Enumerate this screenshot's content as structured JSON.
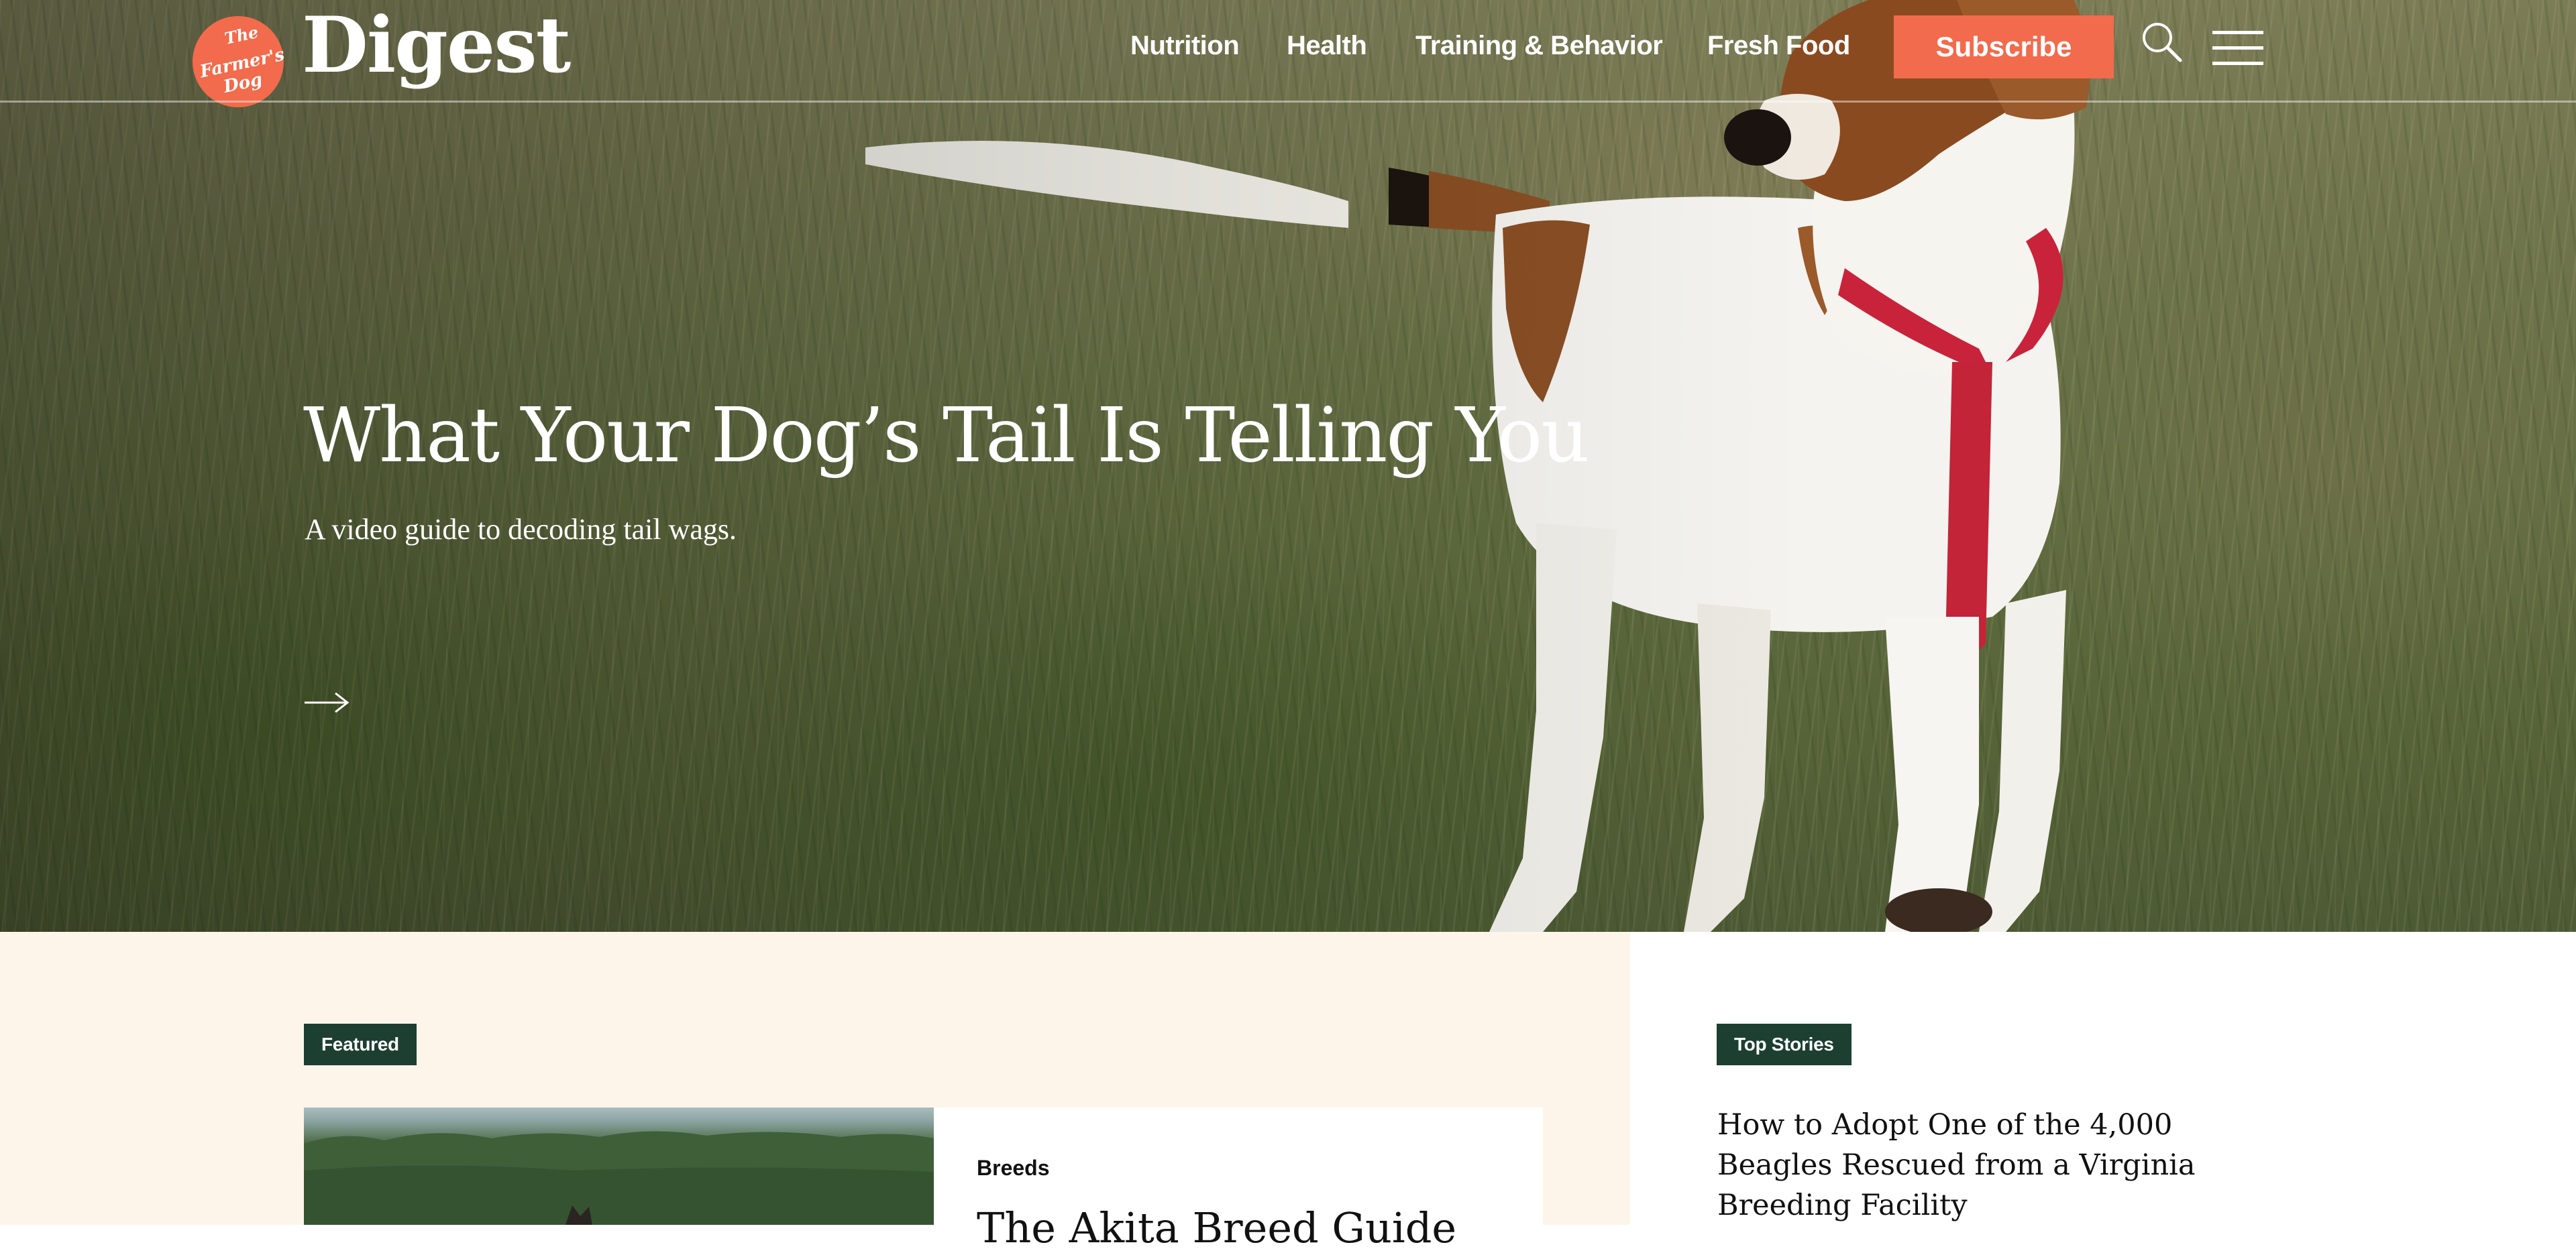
{
  "header": {
    "logo": {
      "badge_text": "The Farmer's Dog",
      "wordmark": "Digest"
    },
    "nav": [
      {
        "label": "Nutrition"
      },
      {
        "label": "Health"
      },
      {
        "label": "Training & Behavior"
      },
      {
        "label": "Fresh Food"
      }
    ],
    "subscribe_label": "Subscribe",
    "icons": {
      "search": "search-icon",
      "menu": "menu-icon"
    }
  },
  "hero": {
    "title": "What Your Dog’s Tail Is Telling You",
    "subtitle": "A video guide to decoding tail wags.",
    "arrow_icon": "arrow-right-icon"
  },
  "featured": {
    "tag": "Featured",
    "category": "Breeds",
    "title": "The Akita Breed Guide"
  },
  "top_stories": {
    "tag": "Top Stories",
    "items": [
      {
        "title": "How to Adopt One of the 4,000 Beagles Rescued from a Virginia Breeding Facility"
      }
    ]
  },
  "colors": {
    "accent": "#f26b4c",
    "tag_bg": "#1c3f32",
    "featured_bg": "#fdf5ea",
    "text_dark": "#111111",
    "white": "#ffffff"
  }
}
